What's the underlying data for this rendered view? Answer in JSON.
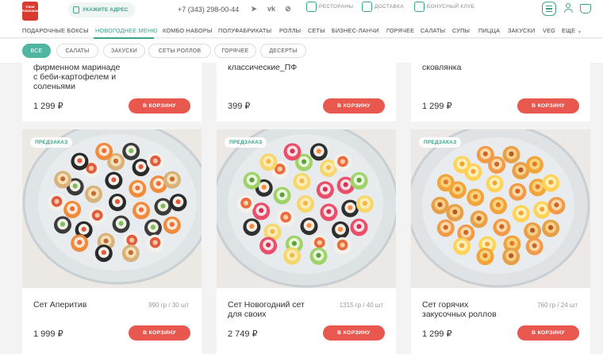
{
  "header": {
    "logo_text": "Своя Компания",
    "address_label": "УКАЖИТЕ АДРЕС",
    "phone": "+7 (343) 298-00-44",
    "social_icons": [
      "telegram-icon",
      "vk-icon",
      "zen-icon"
    ],
    "links": [
      {
        "label": "РЕСТОРАНЫ",
        "icon": "dish-icon"
      },
      {
        "label": "ДОСТАВКА",
        "icon": "bag-icon"
      },
      {
        "label": "БОНУСНЫЙ КЛУБ",
        "icon": "card-icon"
      }
    ]
  },
  "nav": {
    "items": [
      "ПОДАРОЧНЫЕ БОКСЫ",
      "НОВОГОДНЕЕ МЕНЮ",
      "КОМБО НАБОРЫ",
      "ПОЛУФАБРИКАТЫ",
      "РОЛЛЫ",
      "СЕТЫ",
      "БИЗНЕС-ЛАНЧИ",
      "ГОРЯЧЕЕ",
      "САЛАТЫ",
      "СУПЫ",
      "ПИЦЦА",
      "ЗАКУСКИ",
      "VEG",
      "ЕЩЕ ⌄"
    ],
    "active": "НОВОГОДНЕЕ МЕНЮ"
  },
  "filters": {
    "items": [
      "ВСЕ",
      "САЛАТЫ",
      "ЗАКУСКИ",
      "СЕТЫ РОЛЛОВ",
      "ГОРЯЧЕЕ",
      "ДЕСЕРТЫ"
    ],
    "active": "ВСЕ"
  },
  "top_products": [
    {
      "title_lines": [
        "фирменном маринаде",
        "с беби-картофелем и",
        "соленьями"
      ],
      "price": "1 299 ₽",
      "button": "В КОРЗИНУ"
    },
    {
      "title_lines": [
        "классические_ПФ"
      ],
      "price": "399 ₽",
      "button": "В КОРЗИНУ"
    },
    {
      "title_lines": [
        "сковлянка"
      ],
      "price": "1 299 ₽",
      "button": "В КОРЗИНУ"
    }
  ],
  "products": [
    {
      "tag": "ПРЕДЗАКАЗ",
      "title_lines": [
        "Сет Аперитив"
      ],
      "weight": "990 гр / 30 шт",
      "price": "1 999 ₽",
      "button": "В КОРЗИНУ"
    },
    {
      "tag": "ПРЕДЗАКАЗ",
      "title_lines": [
        "Сет Новогодний сет",
        "для своих"
      ],
      "weight": "1315 гр / 40 шт",
      "price": "2 749 ₽",
      "button": "В КОРЗИНУ"
    },
    {
      "tag": "ПРЕДЗАКАЗ",
      "title_lines": [
        "Сет горячих",
        "закусочных роллов"
      ],
      "weight": "760 гр / 24 шт",
      "price": "1 299 ₽",
      "button": "В КОРЗИНУ"
    }
  ],
  "colors": {
    "accent": "#3aa38a",
    "button": "#e8584f",
    "logo": "#d93a2f"
  }
}
